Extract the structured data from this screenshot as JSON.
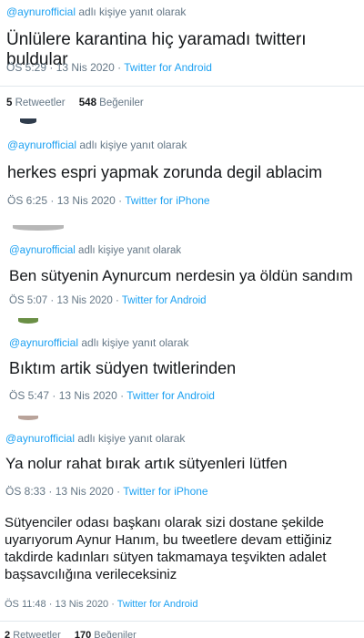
{
  "tweets": [
    {
      "mention": "@aynurofficial",
      "reply_suffix": "adlı kişiye yanıt olarak",
      "text": "Ünlülere karantina hiç yaramadı twitterı buldular",
      "time": "ÖS 5:29",
      "sep": "·",
      "date": "13 Nis 2020",
      "source": "Twitter for Android",
      "stats": {
        "retweets": "5",
        "retweets_label": "Retweetler",
        "likes": "548",
        "likes_label": "Beğeniler"
      }
    },
    {
      "mention": "@aynurofficial",
      "reply_suffix": "adlı kişiye yanıt olarak",
      "text": "herkes espri yapmak zorunda degil ablacim",
      "time": "ÖS 6:25",
      "sep": "·",
      "date": "13 Nis 2020",
      "source": "Twitter for iPhone"
    },
    {
      "mention": "@aynurofficial",
      "reply_suffix": "adlı kişiye yanıt olarak",
      "text": "Ben sütyenin Aynurcum nerdesin ya öldün sandım",
      "time": "ÖS 5:07",
      "sep": "·",
      "date": "13 Nis 2020",
      "source": "Twitter for Android"
    },
    {
      "mention": "@aynurofficial",
      "reply_suffix": "adlı kişiye yanıt olarak",
      "text": "Bıktım artik südyen twitlerinden",
      "time": "ÖS 5:47",
      "sep": "·",
      "date": "13 Nis 2020",
      "source": "Twitter for Android"
    },
    {
      "mention": "@aynurofficial",
      "reply_suffix": "adlı kişiye yanıt olarak",
      "text": "Ya nolur rahat bırak artık sütyenleri lütfen",
      "time": "ÖS 8:33",
      "sep": "·",
      "date": "13 Nis 2020",
      "source": "Twitter for iPhone"
    },
    {
      "text_lines": [
        "Sütyenciler odası başkanı olarak sizi dostane şekilde",
        "uyarıyorum Aynur Hanım, bu tweetlere devam ettiğiniz",
        "takdirde kadınları sütyen takmamaya teşvikten adalet",
        "başsavcılığına verileceksiniz"
      ],
      "time": "ÖS 11:48",
      "sep": "·",
      "date": "13 Nis 2020",
      "source": "Twitter for Android",
      "stats": {
        "retweets": "2",
        "retweets_label": "Retweetler",
        "likes": "170",
        "likes_label": "Beğeniler"
      }
    }
  ],
  "colors": {
    "link": "#1da1f2",
    "meta": "#657786",
    "text": "#14171a",
    "divider": "#e1e8ed"
  }
}
